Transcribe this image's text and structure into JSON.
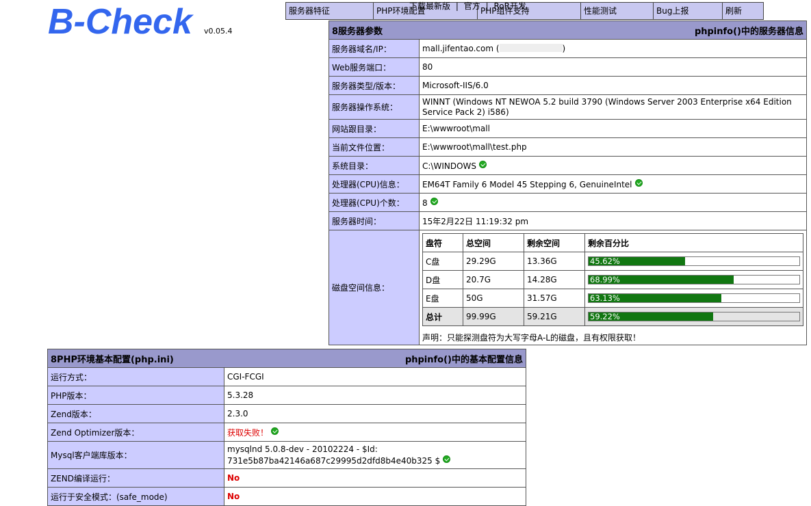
{
  "header": {
    "logo": "B-Check",
    "version": "v0.05.4"
  },
  "nav": {
    "items": [
      "服务器特征",
      "PHP环境配置",
      "PHP组件支持",
      "性能测试",
      "Bug上报",
      "刷新"
    ],
    "overlay_links": [
      "下载最新版",
      "|",
      "官方",
      "|",
      "RoR开发"
    ]
  },
  "server": {
    "title": "8服务器参数",
    "subtitle": "phpinfo()中的服务器信息",
    "rows": [
      {
        "label": "服务器域名/IP：",
        "value": "mall.jifentao.com (",
        "value_tail": ")"
      },
      {
        "label": "Web服务端口：",
        "value": "80"
      },
      {
        "label": "服务器类型/版本：",
        "value": "Microsoft-IIS/6.0"
      },
      {
        "label": "服务器操作系统：",
        "value": "WINNT (Windows NT NEWOA 5.2 build 3790 (Windows Server 2003 Enterprise x64 Edition Service Pack 2) i586)"
      },
      {
        "label": "网站跟目录：",
        "value": "E:\\wwwroot\\mall"
      },
      {
        "label": "当前文件位置：",
        "value": "E:\\wwwroot\\mall\\test.php"
      },
      {
        "label": "系统目录：",
        "value": "C:\\WINDOWS"
      },
      {
        "label": "处理器(CPU)信息：",
        "value": "EM64T Family 6 Model 45 Stepping 6, GenuineIntel"
      },
      {
        "label": "处理器(CPU)个数：",
        "value": "8"
      },
      {
        "label": "服务器时间：",
        "value": "15年2月22日 11:19:32 pm"
      }
    ],
    "disk": {
      "label": "磁盘空间信息：",
      "headers": [
        "盘符",
        "总空间",
        "剩余空间",
        "剩余百分比"
      ],
      "rows": [
        {
          "drive": "C盘",
          "total": "29.29G",
          "free": "13.36G",
          "pct": "45.62%",
          "pct_value": 45.62
        },
        {
          "drive": "D盘",
          "total": "20.7G",
          "free": "14.28G",
          "pct": "68.99%",
          "pct_value": 68.99
        },
        {
          "drive": "E盘",
          "total": "50G",
          "free": "31.57G",
          "pct": "63.13%",
          "pct_value": 63.13
        }
      ],
      "total_row": {
        "drive": "总计",
        "total": "99.99G",
        "free": "59.21G",
        "pct": "59.22%",
        "pct_value": 59.22
      },
      "note": "声明：只能探测盘符为大写字母A-L的磁盘，且有权限获取！"
    }
  },
  "php": {
    "title": "8PHP环境基本配置(php.ini)",
    "subtitle": "phpinfo()中的基本配置信息",
    "rows": [
      {
        "label": "运行方式：",
        "value": "CGI-FCGI"
      },
      {
        "label": "PHP版本：",
        "value": "5.3.28"
      },
      {
        "label": "Zend版本：",
        "value": "2.3.0"
      },
      {
        "label": "Zend Optimizer版本：",
        "value": "获取失败！"
      },
      {
        "label": "Mysql客户端库版本：",
        "value": "mysqlnd 5.0.8-dev - 20102224 - $Id: 731e5b87ba42146a687c29995d2dfd8b4e40b325 $"
      },
      {
        "label": "ZEND编译运行：",
        "value": "No"
      },
      {
        "label": "运行于安全模式：(safe_mode)",
        "value": "No"
      }
    ]
  },
  "colors": {
    "logo": "#3366ee",
    "label_bg": "#ccccff",
    "header_bg": "#9999cc",
    "bar_fill": "#117711",
    "error": "#dd0000"
  }
}
